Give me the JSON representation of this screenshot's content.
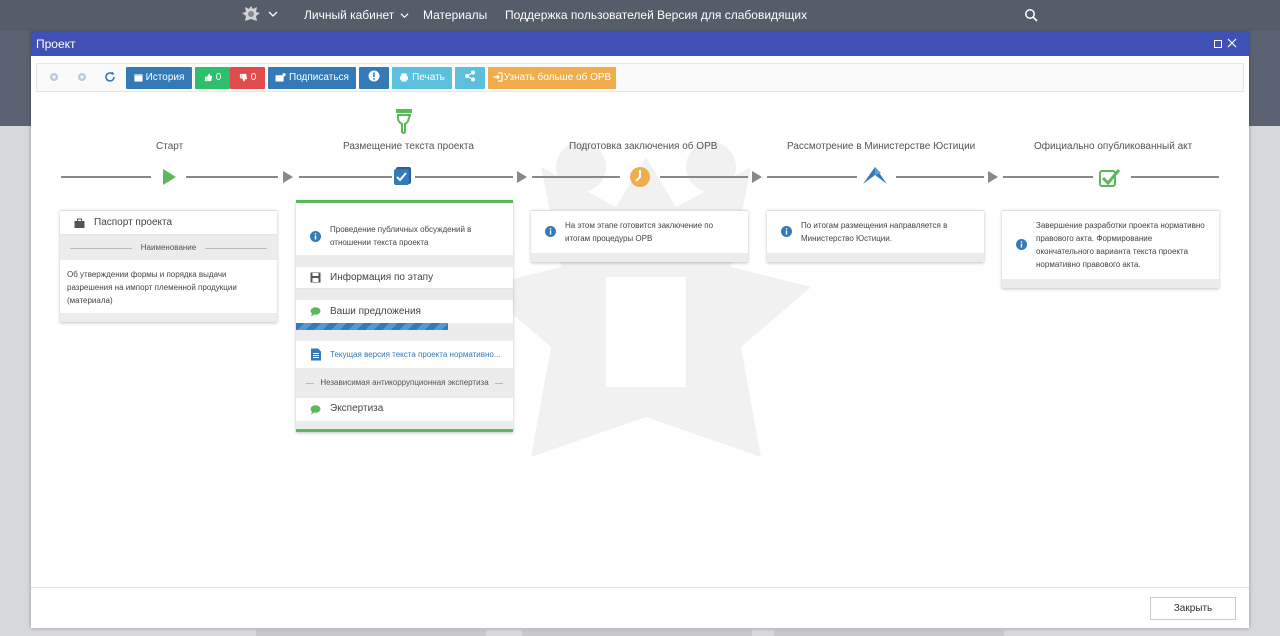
{
  "nav": {
    "items": [
      "Личный кабинет",
      "Материалы",
      "Поддержка пользователей",
      "Версия для слабовидящих"
    ]
  },
  "modal": {
    "title": "Проект",
    "close_label": "Закрыть"
  },
  "toolbar": {
    "history": "История",
    "likes": "0",
    "dislikes": "0",
    "subscribe": "Подписаться",
    "print": "Печать",
    "learn_more": "Узнать больше об ОРВ"
  },
  "stages": [
    {
      "title": "Старт"
    },
    {
      "title": "Размещение текста проекта"
    },
    {
      "title": "Подготовка заключения об ОРВ"
    },
    {
      "title": "Рассмотрение в Министерстве Юстиции"
    },
    {
      "title": "Официально опубликованный акт"
    }
  ],
  "start_card": {
    "passport": "Паспорт проекта",
    "name_label": "Наименование",
    "name_value": "Об утверждении формы и порядка выдачи разрешения на импорт племенной продукции (материала)"
  },
  "placement_card": {
    "info": "Проведение публичных обсуждений в отношении текста проекта",
    "stage_info": "Информация по этапу",
    "proposals": "Ваши предложения",
    "progress_fraction": 0.7,
    "current_version": "Текущая версия текста проекта нормативно...",
    "anticorruption_label": "Независимая антикоррупционная экспертиза",
    "expertise": "Экспертиза"
  },
  "orv_card": {
    "info": "На этом этапе готовится заключение по итогам процедуры ОРВ"
  },
  "justice_card": {
    "info": "По итогам размещения направляется в Министерство Юстиции."
  },
  "published_card": {
    "info": "Завершение разработки проекта нормативно правового акта. Формирование окончательного варианта текста проекта нормативно правового акта."
  },
  "colors": {
    "header": "#3f51b5",
    "green": "#5cb85c",
    "blue": "#337ab7",
    "orange": "#f0ad4e"
  }
}
